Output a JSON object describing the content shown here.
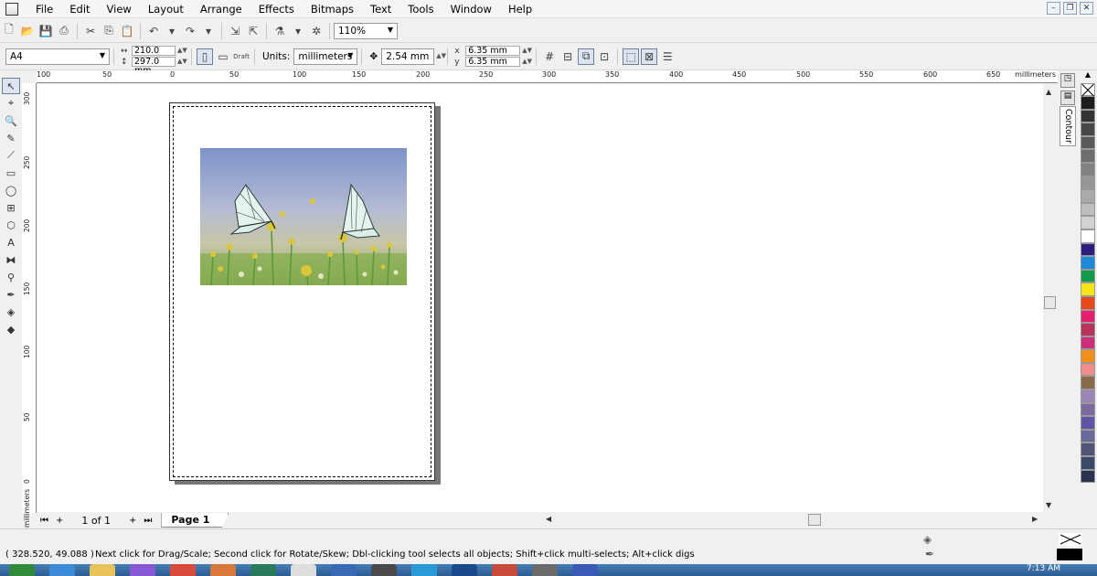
{
  "menu": [
    "File",
    "Edit",
    "View",
    "Layout",
    "Arrange",
    "Effects",
    "Bitmaps",
    "Text",
    "Tools",
    "Window",
    "Help"
  ],
  "toolbar": {
    "zoom": "110%",
    "paper_size": "A4",
    "width": "210.0 mm",
    "height": "297.0 mm",
    "units_label": "Units:",
    "units": "millimeters",
    "nudge": "2.54 mm",
    "dup_x": "6.35 mm",
    "dup_y": "6.35 mm",
    "draft_label": "Draft"
  },
  "ruler": {
    "top_labels": [
      "100",
      "50",
      "0",
      "50",
      "100",
      "150",
      "200",
      "250",
      "300",
      "350",
      "400",
      "450",
      "500",
      "550",
      "600",
      "650"
    ],
    "units_label": "millimeters",
    "left_labels": [
      "300",
      "250",
      "200",
      "150",
      "100",
      "50",
      "0"
    ],
    "left_units_label": "millimeters"
  },
  "dockers": {
    "contour_label": "Contour"
  },
  "palette": [
    "#1e1e1e",
    "#333333",
    "#474747",
    "#5a5a5a",
    "#6e6e6e",
    "#828282",
    "#969696",
    "#aaaaaa",
    "#bebebe",
    "#d2d2d2",
    "#ffffff",
    "#2d1d7d",
    "#1d8ad6",
    "#119a4a",
    "#f5e61a",
    "#e8481a",
    "#e51e6e",
    "#b8345c",
    "#cf2f7a",
    "#f0901a",
    "#f08c8c",
    "#8a6a4a",
    "#9a86b4",
    "#7a6aa0",
    "#5e55a4",
    "#6a6a9a",
    "#505478",
    "#3a4a6a",
    "#2a3450"
  ],
  "pagenav": {
    "count": "1 of 1",
    "page_tab": "Page 1"
  },
  "status": {
    "coords": "( 328.520, 49.088 )",
    "hint": "Next click for Drag/Scale; Second click for Rotate/Skew; Dbl-clicking tool selects all objects; Shift+click multi-selects; Alt+click digs",
    "fill_color": "#ffffff",
    "outline_color": "#000000"
  },
  "taskbar": {
    "clock": "7:13 AM"
  }
}
